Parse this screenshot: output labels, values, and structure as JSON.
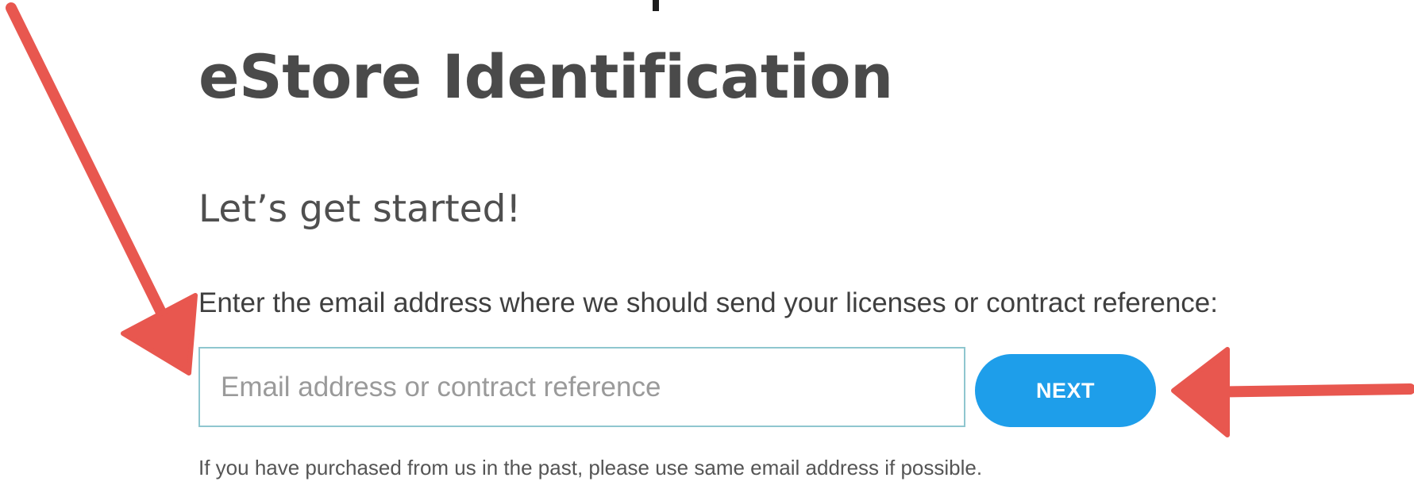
{
  "header": {
    "title": "eStore Identification",
    "subtitle": "Let’s get started!"
  },
  "form": {
    "prompt": "Enter the email address where we should send your licenses or contract reference:",
    "email_placeholder": "Email address or contract reference",
    "email_value": "",
    "next_label": "NEXT",
    "hint": "If you have purchased from us in the past, please use same email address if possible."
  },
  "annotations": {
    "arrow_color": "#e8574f",
    "arrows": [
      "arrow-pointing-to-email-field",
      "arrow-pointing-to-next-button"
    ]
  },
  "colors": {
    "accent": "#1e9eea",
    "field_border": "#8fc6cf",
    "title_text": "#4a4a4a"
  }
}
